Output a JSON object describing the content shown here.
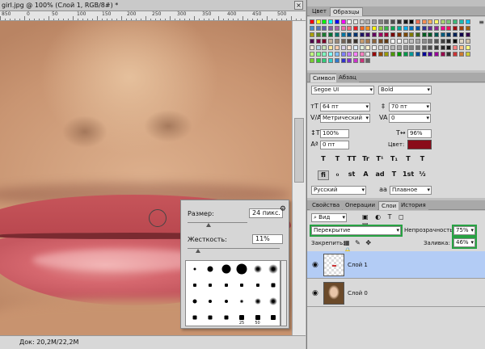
{
  "document": {
    "tab_title": "girl.jpg @ 100% (Слой 1, RGB/8#) *",
    "close_glyph": "×",
    "ruler_labels": [
      "850",
      "0",
      "50",
      "100",
      "150",
      "200",
      "250",
      "300",
      "350",
      "400",
      "450",
      "500"
    ],
    "status_text": "Док: 20,2M/22,2M"
  },
  "brush_popup": {
    "size_label": "Размер:",
    "size_value": "24 пикс.",
    "hardness_label": "Жесткость:",
    "hardness_value": "11%",
    "size_level": 0.35,
    "hardness_level": 0.11,
    "gear_icon": "gear-icon",
    "preset_numbers": [
      "25",
      "50"
    ]
  },
  "swatches_panel": {
    "tabs": [
      "Цвет",
      "Образцы"
    ],
    "active_tab": "Образцы",
    "colors": [
      "#ff0000",
      "#ffff00",
      "#00ff00",
      "#00ffff",
      "#0000ff",
      "#ff00ff",
      "#ffffff",
      "#e6e6e6",
      "#cccccc",
      "#b3b3b3",
      "#999999",
      "#808080",
      "#666666",
      "#4d4d4d",
      "#333333",
      "#1a1a1a",
      "#000000",
      "#f26c4f",
      "#f68e55",
      "#fbaf5c",
      "#fff467",
      "#acd372",
      "#7cc576",
      "#3bb878",
      "#1abbb4",
      "#00bff3",
      "#438cca",
      "#5574b9",
      "#605ca8",
      "#855fa8",
      "#a763a8",
      "#f06eaa",
      "#f26d7d",
      "#ed1c24",
      "#f26522",
      "#f7941d",
      "#fff200",
      "#8dc73f",
      "#39b54a",
      "#00a651",
      "#00a99d",
      "#00aeef",
      "#0072bc",
      "#0054a6",
      "#2e3192",
      "#662d91",
      "#92278f",
      "#ec008c",
      "#ed145b",
      "#9e0b0f",
      "#a0410d",
      "#a36209",
      "#aba000",
      "#598527",
      "#197b30",
      "#007236",
      "#00746b",
      "#0076a3",
      "#004a80",
      "#003471",
      "#1b1464",
      "#440e62",
      "#630460",
      "#9e005d",
      "#9e0039",
      "#790000",
      "#7b2e00",
      "#7d4900",
      "#827b00",
      "#406618",
      "#005e20",
      "#005826",
      "#005952",
      "#005b7f",
      "#003663",
      "#002157",
      "#0d004c",
      "#32004b",
      "#4b0049",
      "#7b0046",
      "#7a0026",
      "#c7b299",
      "#998675",
      "#736357",
      "#534741",
      "#37302a",
      "#c69c6d",
      "#a67c52",
      "#8c6239",
      "#754c24",
      "#603913",
      "#ffffff",
      "#f2f2f2",
      "#d9d9d9",
      "#bfbfbf",
      "#a6a6a6",
      "#8c8c8c",
      "#737373",
      "#595959",
      "#404040",
      "#262626",
      "#0d0d0d",
      "#e0d6c2",
      "#d4c4a8",
      "#f4e3d7",
      "#b5d3e7",
      "#c5e0b4",
      "#ffe699",
      "#f8cbad",
      "#d9d2e9",
      "#fce4d6",
      "#ddebf7",
      "#e2efda",
      "#fff2cc",
      "#ededed",
      "#dbdbdb",
      "#c9c9c9",
      "#b7b7b7",
      "#a5a5a5",
      "#939393",
      "#818181",
      "#6f6f6f",
      "#5d5d5d",
      "#4b4b4b",
      "#393939",
      "#272727",
      "#151515",
      "#ff7f7f",
      "#ffbf7f",
      "#ffff7f",
      "#bfff7f",
      "#7fff7f",
      "#7fffbf",
      "#7fffff",
      "#7fbfff",
      "#7f7fff",
      "#bf7fff",
      "#ff7fff",
      "#ff7fbf",
      "#e5e5e5",
      "#990000",
      "#994c00",
      "#999900",
      "#4c9900",
      "#009900",
      "#00994c",
      "#009999",
      "#004c99",
      "#000099",
      "#4c0099",
      "#990099",
      "#99004c",
      "#333333",
      "#cc3333",
      "#cc7a33",
      "#cccc33",
      "#7acc33",
      "#33cc33",
      "#33cc7a",
      "#33cccc",
      "#337acc",
      "#3333cc",
      "#7a33cc",
      "#cc33cc",
      "#cc337a",
      "#666666"
    ]
  },
  "character_panel": {
    "tabs": [
      "Символ",
      "Абзац"
    ],
    "active_tab": "Символ",
    "font_family": "Segoe UI",
    "font_style": "Bold",
    "font_size": "64 пт",
    "leading": "70 пт",
    "kerning": "Метрический",
    "tracking": "0",
    "vertical_scale": "100%",
    "horizontal_scale": "96%",
    "baseline_shift": "0 пт",
    "color_label": "Цвет:",
    "color_value": "#8a0c1a",
    "style_buttons": [
      "T",
      "T",
      "TT",
      "Tr",
      "T¹",
      "T₁",
      "T",
      "T"
    ],
    "opentype_buttons": [
      "fi",
      "ℴ",
      "st",
      "A",
      "ad",
      "T",
      "1st",
      "½"
    ],
    "language": "Русский",
    "antialias_icon": "aa",
    "antialias": "Плавное"
  },
  "layers_panel": {
    "tabs": [
      "Свойства",
      "Операции",
      "Слои",
      "История"
    ],
    "active_tab": "Слои",
    "filter_label": "Вид",
    "blend_mode": "Перекрытие",
    "opacity_label": "Непрозрачность:",
    "opacity_value": "75%",
    "lock_label": "Закрепить:",
    "fill_label": "Заливка:",
    "fill_value": "46%",
    "layers": [
      {
        "name": "Слой 1",
        "selected": true
      },
      {
        "name": "Слой 0",
        "selected": false
      }
    ]
  }
}
